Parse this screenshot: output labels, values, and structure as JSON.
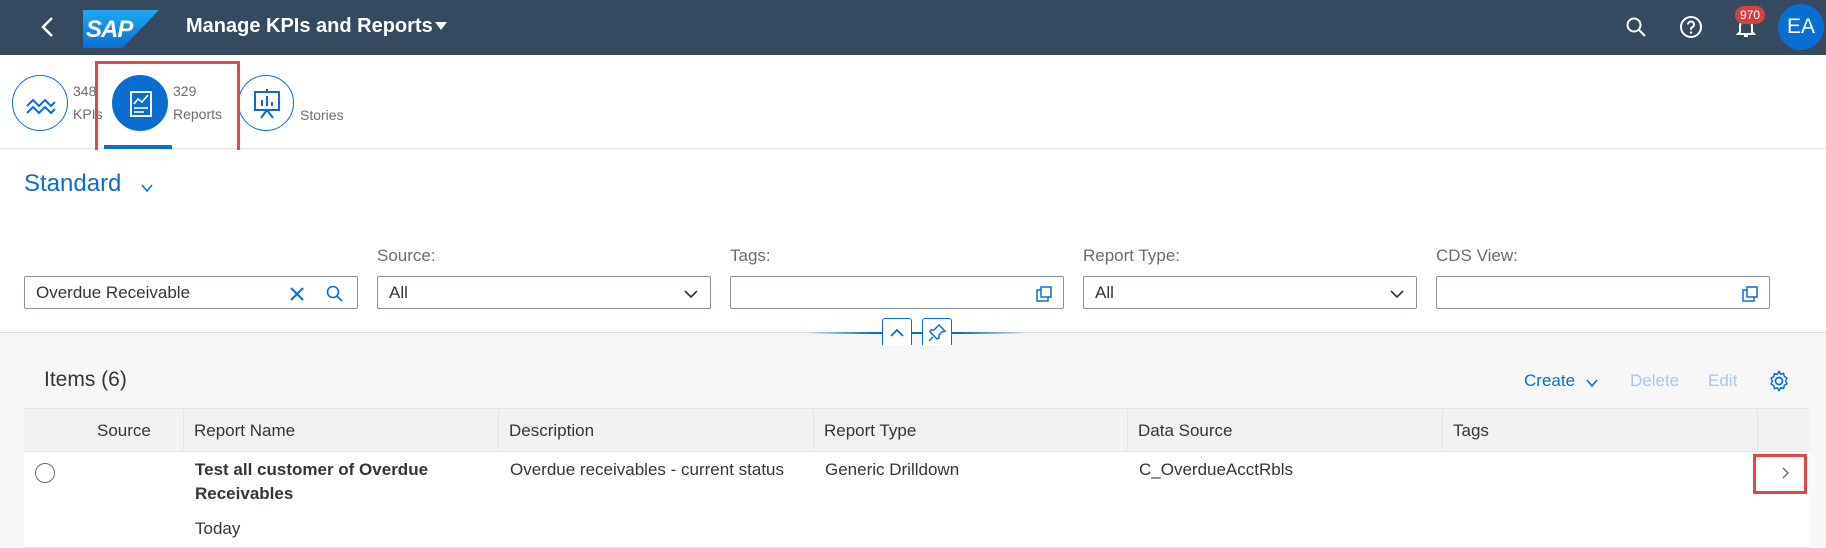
{
  "shell": {
    "logo_text": "SAP",
    "title": "Manage KPIs and Reports",
    "notification_count": "970",
    "avatar_initials": "EA",
    "brand_color": "#354a5f",
    "accent_color": "#0a6ed1",
    "icons": [
      "back-icon",
      "search-icon",
      "help-icon",
      "bell-icon"
    ]
  },
  "tabs": [
    {
      "count": "348",
      "label": "KPIs",
      "icon": "kpi-trend-icon",
      "selected": false
    },
    {
      "count": "329",
      "label": "Reports",
      "icon": "report-icon",
      "selected": true
    },
    {
      "count": "",
      "label": "Stories",
      "icon": "presentation-icon",
      "selected": false
    }
  ],
  "filterbar": {
    "variant": "Standard",
    "search_value": "Overdue Receivable",
    "source_label": "Source:",
    "source_value": "All",
    "tags_label": "Tags:",
    "tags_value": "",
    "report_type_label": "Report Type:",
    "report_type_value": "All",
    "cds_view_label": "CDS View:",
    "cds_view_value": ""
  },
  "table": {
    "title": "Items (6)",
    "toolbar": {
      "create": "Create",
      "delete": "Delete",
      "edit": "Edit"
    },
    "columns": [
      "Source",
      "Report Name",
      "Description",
      "Report Type",
      "Data Source",
      "Tags"
    ],
    "rows": [
      {
        "source": "",
        "report_name_line1": "Test all customer of Overdue",
        "report_name_line2": "Receivables",
        "report_modified": "Today",
        "description": "Overdue receivables - current status",
        "report_type": "Generic Drilldown",
        "data_source": "C_OverdueAcctRbls",
        "tags": ""
      }
    ]
  }
}
